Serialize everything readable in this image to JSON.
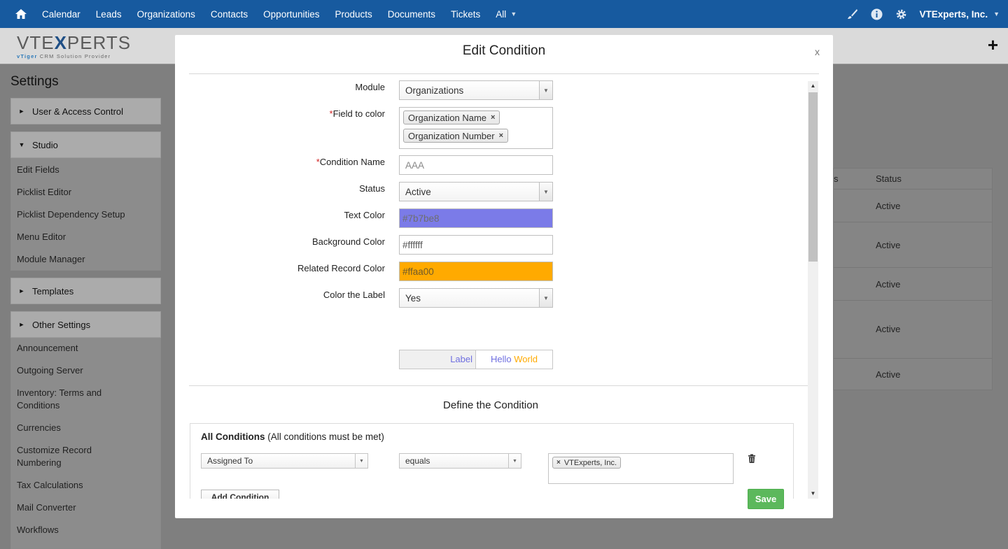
{
  "topnav": {
    "items": [
      "Calendar",
      "Leads",
      "Organizations",
      "Contacts",
      "Opportunities",
      "Products",
      "Documents",
      "Tickets"
    ],
    "all_label": "All",
    "company": "VTExperts, Inc."
  },
  "logo": {
    "brand_left": "VTE",
    "brand_x": "X",
    "brand_right": "PERTS",
    "tag_left": "vTiger",
    "tag_right": "CRM Solution Provider"
  },
  "sidebar": {
    "title": "Settings",
    "sections": {
      "user_access": "User & Access Control",
      "studio": "Studio",
      "templates": "Templates",
      "other": "Other Settings"
    },
    "studio_items": [
      "Edit Fields",
      "Picklist Editor",
      "Picklist Dependency Setup",
      "Menu Editor",
      "Module Manager"
    ],
    "other_items": [
      "Announcement",
      "Outgoing Server",
      "Inventory: Terms and Conditions",
      "Currencies",
      "Customize Record Numbering",
      "Tax Calculations",
      "Mail Converter",
      "Workflows"
    ]
  },
  "bg_table": {
    "col_partial": "s",
    "col_status": "Status",
    "rows": [
      "Active",
      "Active",
      "Active",
      "Active",
      "Active"
    ]
  },
  "modal": {
    "title": "Edit Condition",
    "close": "x",
    "fields": {
      "module_label": "Module",
      "module_value": "Organizations",
      "field_to_color_label": "Field to color",
      "field_chips": [
        "Organization Name",
        "Organization Number"
      ],
      "condition_name_label": "Condition Name",
      "condition_name_value": "AAA",
      "status_label": "Status",
      "status_value": "Active",
      "text_color_label": "Text Color",
      "text_color_value": "#7b7be8",
      "background_color_label": "Background Color",
      "background_color_value": "#ffffff",
      "related_record_color_label": "Related Record Color",
      "related_record_color_value": "#ffaa00",
      "color_label_label": "Color the Label",
      "color_label_value": "Yes",
      "preview_label": "Label",
      "preview_hello": "Hello",
      "preview_world": "World"
    },
    "required_mark": "*",
    "define_title": "Define the Condition",
    "conditions": {
      "all_title": "All Conditions",
      "all_subtitle": "(All conditions must be met)",
      "field": "Assigned To",
      "operator": "equals",
      "value_chip": "VTExperts, Inc.",
      "add_button": "Add Condition"
    },
    "save_button": "Save"
  },
  "colors": {
    "nav_bg": "#175a9f",
    "text_color": "#7b7be8",
    "related_color": "#ffaa00",
    "save_bg": "#5cb85c"
  }
}
